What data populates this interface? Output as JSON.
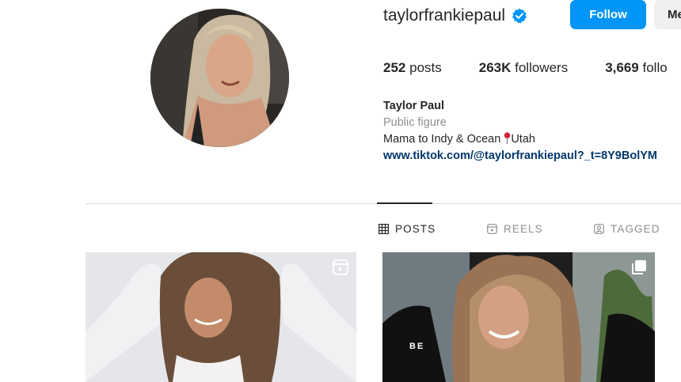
{
  "profile": {
    "username": "taylorfrankiepaul",
    "verified_icon": "verified-badge-icon",
    "follow_label": "Follow",
    "more_label": "Me",
    "stats": {
      "posts_count": "252",
      "posts_label": "posts",
      "followers_count": "263K",
      "followers_label": "followers",
      "following_count": "3,669",
      "following_label": "follo"
    },
    "bio": {
      "name": "Taylor Paul",
      "category": "Public figure",
      "line_before_pin": "Mama to Indy & Ocean ",
      "line_after_pin": "Utah",
      "pin_icon": "pushpin-icon",
      "link": "www.tiktok.com/@taylorfrankiepaul?_t=8Y9BolYM"
    }
  },
  "tabs": [
    {
      "label": "POSTS",
      "icon": "grid-icon",
      "active": true
    },
    {
      "label": "REELS",
      "icon": "reels-icon",
      "active": false
    },
    {
      "label": "TAGGED",
      "icon": "tagged-icon",
      "active": false
    }
  ],
  "posts": [
    {
      "type_icon": "reel-icon"
    },
    {
      "type_icon": "carousel-icon",
      "overlay_text": "BE"
    }
  ],
  "colors": {
    "follow_button": "#0095f6",
    "link": "#00376b",
    "verified": "#0095f6",
    "secondary_text": "#8e8e8e"
  }
}
